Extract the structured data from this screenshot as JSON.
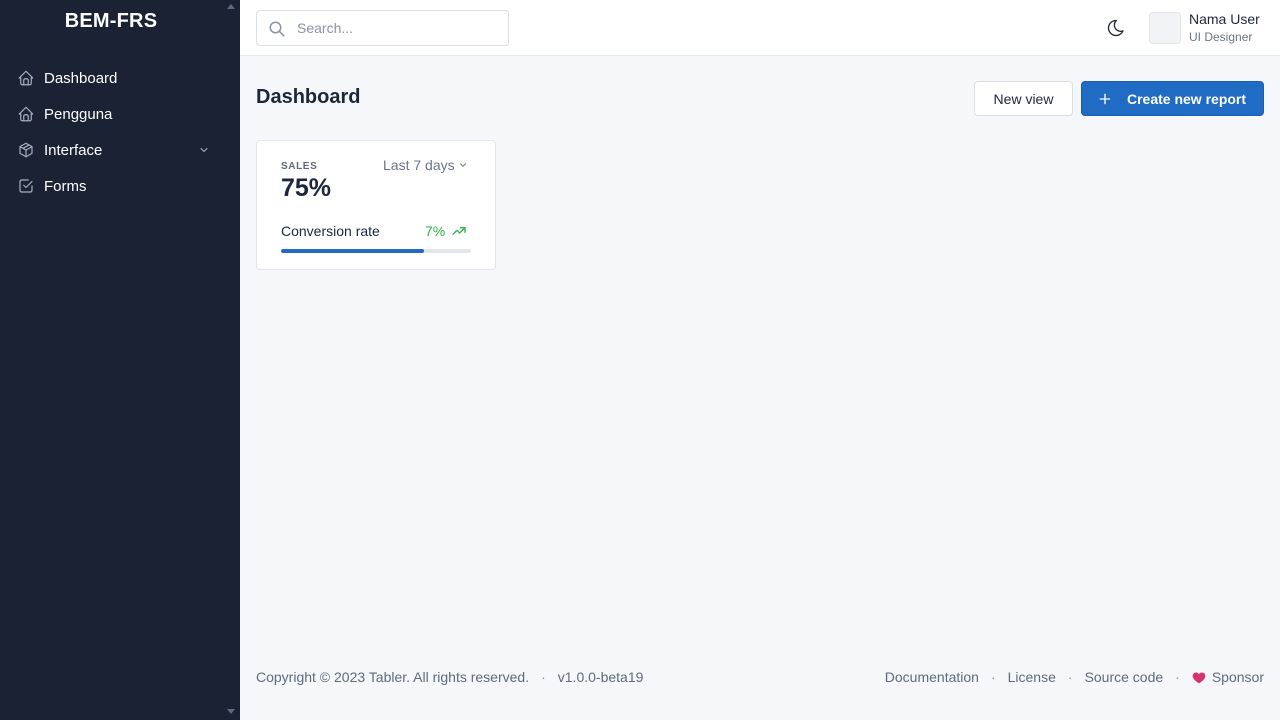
{
  "sidebar": {
    "brand": "BEM-FRS",
    "items": [
      {
        "label": "Dashboard",
        "icon": "home-icon"
      },
      {
        "label": "Pengguna",
        "icon": "home-icon"
      },
      {
        "label": "Interface",
        "icon": "package-icon",
        "has_submenu": true
      },
      {
        "label": "Forms",
        "icon": "checkbox-icon"
      }
    ]
  },
  "header": {
    "search": {
      "placeholder": "Search...",
      "value": ""
    },
    "user": {
      "name": "Nama User",
      "role": "UI Designer"
    }
  },
  "page": {
    "title": "Dashboard",
    "buttons": {
      "new_view": "New view",
      "create_report": "Create new report"
    }
  },
  "card": {
    "subheader": "SALES",
    "range": "Last 7 days",
    "value": "75%",
    "metric_label": "Conversion rate",
    "trend": "7%",
    "progress": 0.75
  },
  "footer": {
    "copyright": "Copyright © 2023 Tabler. All rights reserved.",
    "version": "v1.0.0-beta19",
    "links": [
      "Documentation",
      "License",
      "Source code",
      "Sponsor"
    ]
  },
  "colors": {
    "sidebar_bg": "#1a2234",
    "primary": "#206bc4",
    "success": "#2fb344",
    "heart": "#d6336c",
    "page_bg": "#f5f7fb"
  }
}
